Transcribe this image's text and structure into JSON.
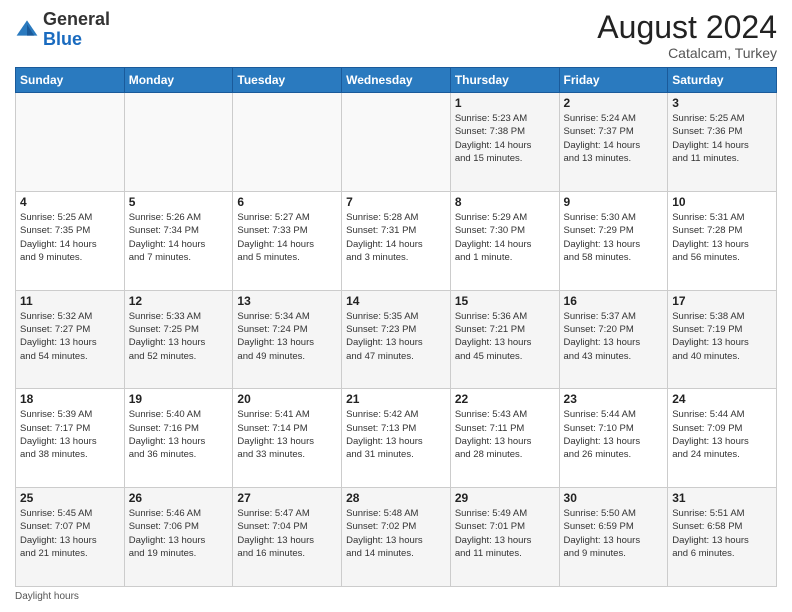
{
  "header": {
    "logo_general": "General",
    "logo_blue": "Blue",
    "month_title": "August 2024",
    "location": "Catalcam, Turkey"
  },
  "footer": {
    "note": "Daylight hours"
  },
  "days_of_week": [
    "Sunday",
    "Monday",
    "Tuesday",
    "Wednesday",
    "Thursday",
    "Friday",
    "Saturday"
  ],
  "weeks": [
    [
      {
        "day": "",
        "info": ""
      },
      {
        "day": "",
        "info": ""
      },
      {
        "day": "",
        "info": ""
      },
      {
        "day": "",
        "info": ""
      },
      {
        "day": "1",
        "info": "Sunrise: 5:23 AM\nSunset: 7:38 PM\nDaylight: 14 hours\nand 15 minutes."
      },
      {
        "day": "2",
        "info": "Sunrise: 5:24 AM\nSunset: 7:37 PM\nDaylight: 14 hours\nand 13 minutes."
      },
      {
        "day": "3",
        "info": "Sunrise: 5:25 AM\nSunset: 7:36 PM\nDaylight: 14 hours\nand 11 minutes."
      }
    ],
    [
      {
        "day": "4",
        "info": "Sunrise: 5:25 AM\nSunset: 7:35 PM\nDaylight: 14 hours\nand 9 minutes."
      },
      {
        "day": "5",
        "info": "Sunrise: 5:26 AM\nSunset: 7:34 PM\nDaylight: 14 hours\nand 7 minutes."
      },
      {
        "day": "6",
        "info": "Sunrise: 5:27 AM\nSunset: 7:33 PM\nDaylight: 14 hours\nand 5 minutes."
      },
      {
        "day": "7",
        "info": "Sunrise: 5:28 AM\nSunset: 7:31 PM\nDaylight: 14 hours\nand 3 minutes."
      },
      {
        "day": "8",
        "info": "Sunrise: 5:29 AM\nSunset: 7:30 PM\nDaylight: 14 hours\nand 1 minute."
      },
      {
        "day": "9",
        "info": "Sunrise: 5:30 AM\nSunset: 7:29 PM\nDaylight: 13 hours\nand 58 minutes."
      },
      {
        "day": "10",
        "info": "Sunrise: 5:31 AM\nSunset: 7:28 PM\nDaylight: 13 hours\nand 56 minutes."
      }
    ],
    [
      {
        "day": "11",
        "info": "Sunrise: 5:32 AM\nSunset: 7:27 PM\nDaylight: 13 hours\nand 54 minutes."
      },
      {
        "day": "12",
        "info": "Sunrise: 5:33 AM\nSunset: 7:25 PM\nDaylight: 13 hours\nand 52 minutes."
      },
      {
        "day": "13",
        "info": "Sunrise: 5:34 AM\nSunset: 7:24 PM\nDaylight: 13 hours\nand 49 minutes."
      },
      {
        "day": "14",
        "info": "Sunrise: 5:35 AM\nSunset: 7:23 PM\nDaylight: 13 hours\nand 47 minutes."
      },
      {
        "day": "15",
        "info": "Sunrise: 5:36 AM\nSunset: 7:21 PM\nDaylight: 13 hours\nand 45 minutes."
      },
      {
        "day": "16",
        "info": "Sunrise: 5:37 AM\nSunset: 7:20 PM\nDaylight: 13 hours\nand 43 minutes."
      },
      {
        "day": "17",
        "info": "Sunrise: 5:38 AM\nSunset: 7:19 PM\nDaylight: 13 hours\nand 40 minutes."
      }
    ],
    [
      {
        "day": "18",
        "info": "Sunrise: 5:39 AM\nSunset: 7:17 PM\nDaylight: 13 hours\nand 38 minutes."
      },
      {
        "day": "19",
        "info": "Sunrise: 5:40 AM\nSunset: 7:16 PM\nDaylight: 13 hours\nand 36 minutes."
      },
      {
        "day": "20",
        "info": "Sunrise: 5:41 AM\nSunset: 7:14 PM\nDaylight: 13 hours\nand 33 minutes."
      },
      {
        "day": "21",
        "info": "Sunrise: 5:42 AM\nSunset: 7:13 PM\nDaylight: 13 hours\nand 31 minutes."
      },
      {
        "day": "22",
        "info": "Sunrise: 5:43 AM\nSunset: 7:11 PM\nDaylight: 13 hours\nand 28 minutes."
      },
      {
        "day": "23",
        "info": "Sunrise: 5:44 AM\nSunset: 7:10 PM\nDaylight: 13 hours\nand 26 minutes."
      },
      {
        "day": "24",
        "info": "Sunrise: 5:44 AM\nSunset: 7:09 PM\nDaylight: 13 hours\nand 24 minutes."
      }
    ],
    [
      {
        "day": "25",
        "info": "Sunrise: 5:45 AM\nSunset: 7:07 PM\nDaylight: 13 hours\nand 21 minutes."
      },
      {
        "day": "26",
        "info": "Sunrise: 5:46 AM\nSunset: 7:06 PM\nDaylight: 13 hours\nand 19 minutes."
      },
      {
        "day": "27",
        "info": "Sunrise: 5:47 AM\nSunset: 7:04 PM\nDaylight: 13 hours\nand 16 minutes."
      },
      {
        "day": "28",
        "info": "Sunrise: 5:48 AM\nSunset: 7:02 PM\nDaylight: 13 hours\nand 14 minutes."
      },
      {
        "day": "29",
        "info": "Sunrise: 5:49 AM\nSunset: 7:01 PM\nDaylight: 13 hours\nand 11 minutes."
      },
      {
        "day": "30",
        "info": "Sunrise: 5:50 AM\nSunset: 6:59 PM\nDaylight: 13 hours\nand 9 minutes."
      },
      {
        "day": "31",
        "info": "Sunrise: 5:51 AM\nSunset: 6:58 PM\nDaylight: 13 hours\nand 6 minutes."
      }
    ]
  ]
}
